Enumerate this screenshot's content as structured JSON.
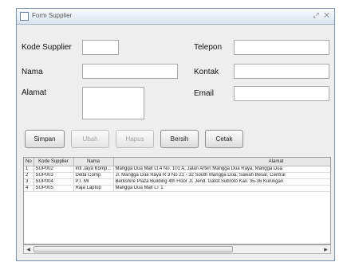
{
  "window": {
    "title": "Form Supplier",
    "controls": "⤢ ✕"
  },
  "form": {
    "kode_label": "Kode Supplier",
    "nama_label": "Nama",
    "alamat_label": "Alamat",
    "telepon_label": "Telepon",
    "kontak_label": "Kontak",
    "email_label": "Email",
    "kode_value": "",
    "nama_value": "",
    "alamat_value": "",
    "telepon_value": "",
    "kontak_value": "",
    "email_value": ""
  },
  "buttons": {
    "simpan": "Simpan",
    "ubah": "Ubah",
    "hapus": "Hapus",
    "bersih": "Bersih",
    "cetak": "Cetak"
  },
  "table": {
    "headers": [
      "No",
      "Kode Supplier",
      "Nama",
      "Alamat"
    ],
    "rows": [
      [
        "1",
        "SUP002",
        "Inti Jaya Komp...",
        "Mangga Dua Mall Lt.4 No. 101 A, Jalan Arteri Mangga Dua Raya, Mangga Dua"
      ],
      [
        "2",
        "SUP003",
        "Delta Comp",
        "Jl. Mangga Dua Raya R 3 No 21 - 32 South Mangga Dua, Sawah Besar, Central"
      ],
      [
        "3",
        "SUP004",
        "PT. MI",
        "Berkshire Plaza Building 4th Floor Jl. Jend. Gatot Subroto Kav. 35-36 Kuningan"
      ],
      [
        "4",
        "SUP005",
        "Raja Laptop",
        "Mangga Dua Mall LT 1"
      ]
    ]
  },
  "scrollbar": {
    "left_arrow": "◀",
    "right_arrow": "▶"
  }
}
